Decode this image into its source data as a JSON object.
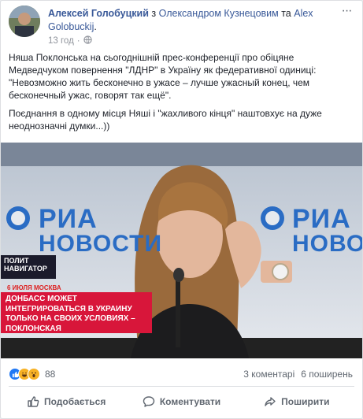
{
  "post": {
    "author": "Алексей Голобуцкий",
    "with_word": " з ",
    "tagged_1": "Олександром Кузнецовим",
    "and_word": " та ",
    "tagged_2": "Alex Golobuckij",
    "period": ".",
    "time": "13 год",
    "separator": "·",
    "paragraph_1": "Няша Поклонська на сьогоднішній прес-конференції про обіцяне Медведчуком повернення \"ЛДНР\" в Україну як федеративної одиниці: \"Невозможно жить бесконечно в ужасе – лучше ужасный конец, чем бесконечный ужас, говорят так ещё\".",
    "paragraph_2": "Поєднання в одному місця Няші і \"жахливого кінця\" наштовхує на дуже неоднозначні думки...))"
  },
  "video": {
    "logo_top": "РИА",
    "logo_bottom": "НОВОСТИ",
    "logo_top_right": "РИА",
    "logo_bottom_right": "НОВОСТ",
    "chyron_top": "ПОЛИТ НАВИГАТОР",
    "chyron_date": "6 ИЮЛЯ МОСКВА",
    "chyron_text": "ДОНБАСС МОЖЕТ ИНТЕГРИРОВАТЬСЯ В УКРАИНУ ТОЛЬКО НА СВОИХ УСЛОВИЯХ – ПОКЛОНСКАЯ"
  },
  "footer": {
    "reaction_count": "88",
    "comments": "3 коментарі",
    "shares": "6 поширень",
    "like_label": "Подобається",
    "comment_label": "Коментувати",
    "share_label": "Поширити"
  },
  "colors": {
    "link": "#385898",
    "like_blue": "#2078f4",
    "chyron_red": "#d8163a"
  }
}
